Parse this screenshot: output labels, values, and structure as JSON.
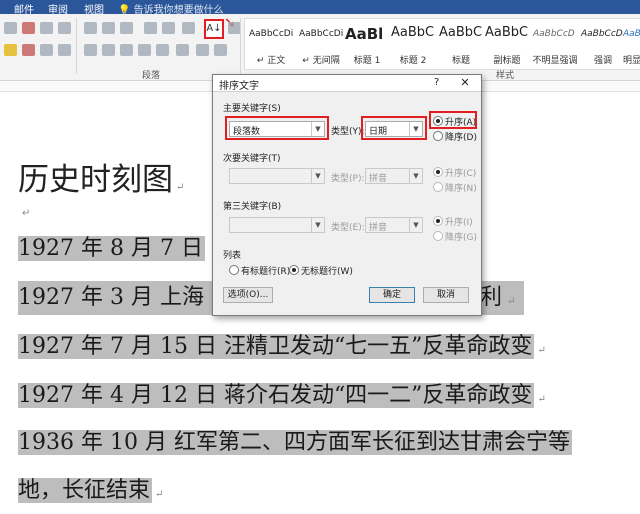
{
  "ribbon": {
    "tabs": [
      "邮件",
      "审阅",
      "视图"
    ],
    "tell_me": "告诉我你想要做什么",
    "paragraph_group": "段落",
    "styles_group": "样式",
    "sort_icon": "sort-az-icon",
    "styles": [
      {
        "sample": "AaBbCcDi",
        "name": "↵ 正文"
      },
      {
        "sample": "AaBbCcDi",
        "name": "↵ 无间隔"
      },
      {
        "sample": "AaBl",
        "name": "标题 1"
      },
      {
        "sample": "AaBbC",
        "name": "标题 2"
      },
      {
        "sample": "AaBbC",
        "name": "标题"
      },
      {
        "sample": "AaBbC",
        "name": "副标题"
      },
      {
        "sample": "AaBbCcD",
        "name": "不明显强调"
      },
      {
        "sample": "AaBbCcD",
        "name": "强调"
      },
      {
        "sample": "AaBbCcD",
        "name": "明显"
      }
    ]
  },
  "document": {
    "heading": "历史时刻图",
    "lines": [
      "1927 年 8 月 7 日",
      "1927 年 3 月    上海",
      "1927 年 7 月 15 日    汪精卫发动“七一五”反革命政变",
      "1927 年 4 月 12 日    蒋介石发动“四一二”反革命政变",
      "1936 年 10 月    红军第二、四方面军长征到达甘肃会宁等",
      "地，长征结束"
    ],
    "line2_tail": "利"
  },
  "dialog": {
    "title": "排序文字",
    "help": "?",
    "close": "✕",
    "primary": {
      "label": "主要关键字(S)",
      "value": "段落数",
      "type_label": "类型(Y):",
      "type_value": "日期",
      "asc": "升序(A)",
      "desc": "降序(D)",
      "asc_selected": true
    },
    "secondary": {
      "label": "次要关键字(T)",
      "value": "",
      "type_label": "类型(P):",
      "type_value": "拼音",
      "asc": "升序(C)",
      "desc": "降序(N)"
    },
    "tertiary": {
      "label": "第三关键字(B)",
      "value": "",
      "type_label": "类型(E):",
      "type_value": "拼音",
      "asc": "升序(I)",
      "desc": "降序(G)"
    },
    "list": {
      "label": "列表",
      "header": "有标题行(R)",
      "no_header": "无标题行(W)",
      "no_header_selected": true
    },
    "options_button": "选项(O)...",
    "ok_button": "确定",
    "cancel_button": "取消"
  }
}
